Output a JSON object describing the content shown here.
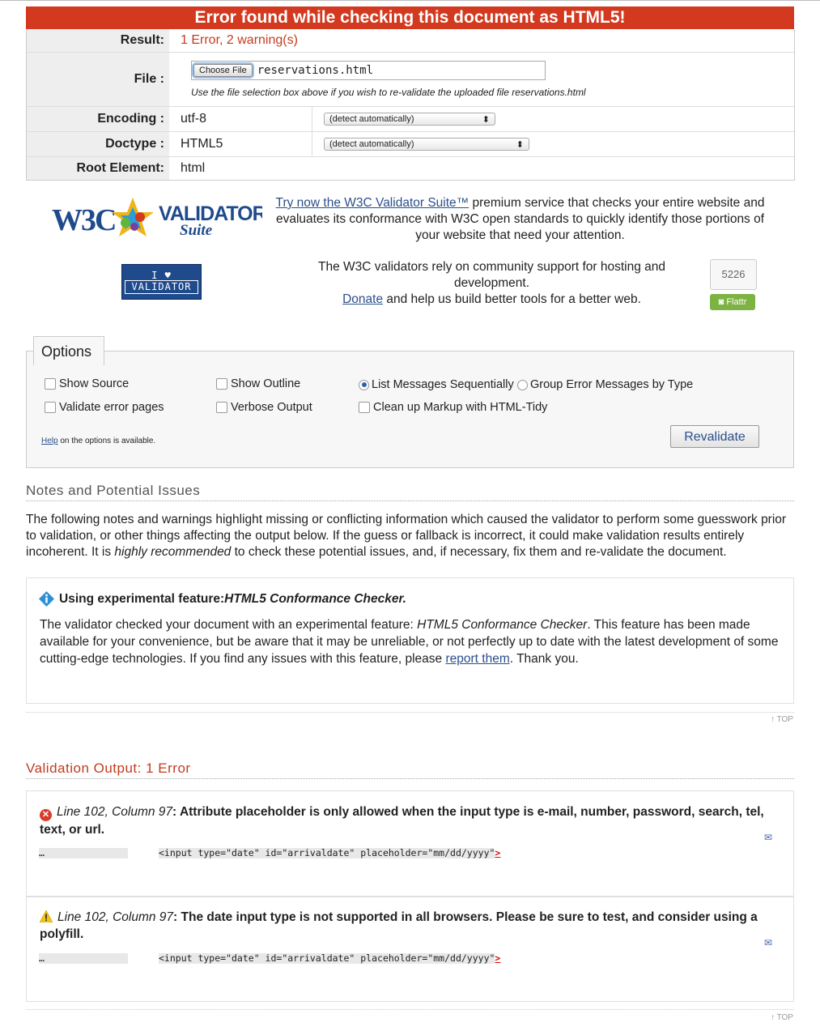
{
  "banner": {
    "title": "Error found while checking this document as HTML5!"
  },
  "result_table": {
    "result": {
      "label": "Result:",
      "value": "1 Error, 2 warning(s)"
    },
    "file": {
      "label": "File :",
      "button": "Choose File",
      "filename": "reservations.html",
      "hint": "Use the file selection box above if you wish to re-validate the uploaded file reservations.html"
    },
    "encoding": {
      "label": "Encoding :",
      "value": "utf-8",
      "select": "(detect automatically)"
    },
    "doctype": {
      "label": "Doctype :",
      "value": "HTML5",
      "select": "(detect automatically)"
    },
    "root": {
      "label": "Root Element:",
      "value": "html"
    }
  },
  "suite_logo": {
    "w3c": "W3C",
    "validator": "VALIDATOR",
    "suite": "Suite"
  },
  "promo1": {
    "link": "Try now the W3C Validator Suite™",
    "text": " premium service that checks your entire website and evaluates its conformance with W3C open standards to quickly identify those portions of your website that need your attention."
  },
  "ilove": {
    "line1": "I ♥",
    "line2": "VALIDATOR"
  },
  "promo2": {
    "text1": "The W3C validators rely on community support for hosting and development.",
    "link": "Donate",
    "text2": " and help us build better tools for a better web."
  },
  "flattr": {
    "count": "5226",
    "label": "Flattr"
  },
  "options": {
    "tab": "Options",
    "items": {
      "show_source": "Show Source",
      "show_outline": "Show Outline",
      "list_sequential": "List Messages Sequentially",
      "group_by_type": "Group Error Messages by Type",
      "validate_error_pages": "Validate error pages",
      "verbose_output": "Verbose Output",
      "cleanup_tidy": "Clean up Markup with HTML-Tidy"
    },
    "help_link": "Help",
    "help_text": " on the options is available.",
    "revalidate": "Revalidate"
  },
  "notes": {
    "heading": "Notes and Potential Issues",
    "intro_a": "The following notes and warnings highlight missing or conflicting information which caused the validator to perform some guesswork prior to validation, or other things affecting the output below. If the guess or fallback is incorrect, it could make validation results entirely incoherent. It is ",
    "intro_em": "highly recommended",
    "intro_b": " to check these potential issues, and, if necessary, fix them and re-validate the document.",
    "note_title_a": "Using experimental feature: ",
    "note_title_em": "HTML5 Conformance Checker.",
    "note_body_a": "The validator checked your document with an experimental feature: ",
    "note_body_em": "HTML5 Conformance Checker",
    "note_body_b": ". This feature has been made available for your convenience, but be aware that it may be unreliable, or not perfectly up to date with the latest development of some cutting-edge technologies. If you find any issues with this feature, please ",
    "note_link": "report them",
    "note_body_c": ". Thank you."
  },
  "top_link": "↑ TOP",
  "validation": {
    "heading": "Validation Output: 1 Error",
    "messages": [
      {
        "location": "Line 102, Column 97",
        "text": "Attribute placeholder is only allowed when the input type is e-mail, number, password, search, tel, text, or url.",
        "ellipsis": "…",
        "source": "<input type=\"date\" id=\"arrivaldate\" placeholder=\"mm/dd/yyyy\"",
        "marker": ">"
      },
      {
        "location": "Line 102, Column 97",
        "text": "The date input type is not supported in all browsers. Please be sure to test, and consider using a polyfill.",
        "ellipsis": "…",
        "source": "<input type=\"date\" id=\"arrivaldate\" placeholder=\"mm/dd/yyyy\"",
        "marker": ">"
      }
    ]
  },
  "colors": {
    "banner": "#d2391f",
    "error_text": "#c33b1e",
    "link": "#2b4f8c"
  }
}
